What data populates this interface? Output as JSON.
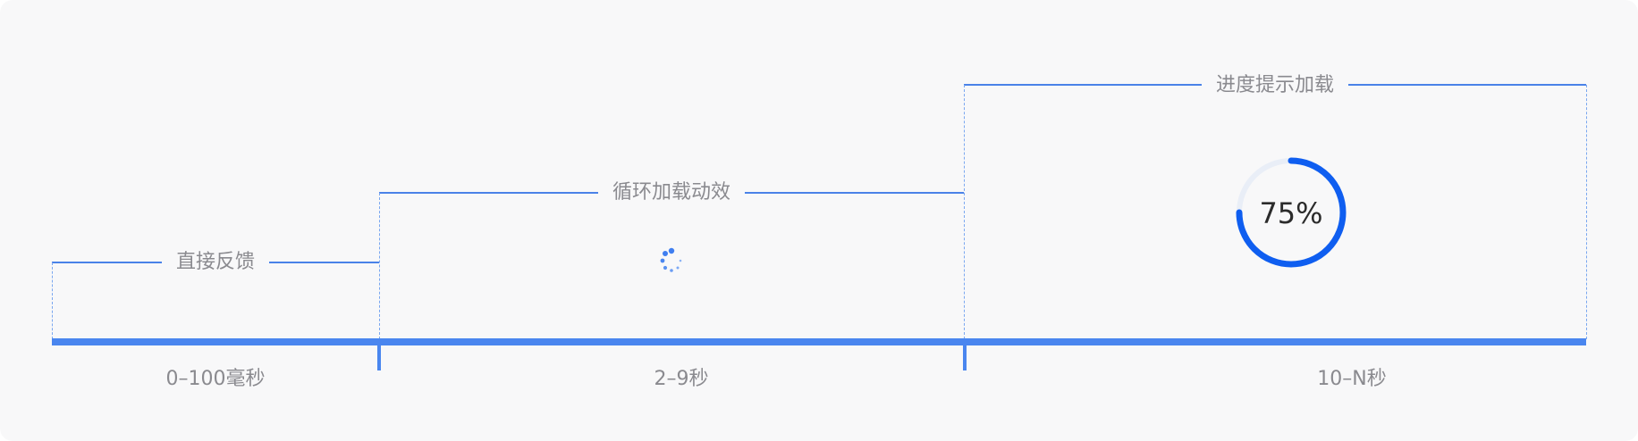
{
  "stages": [
    {
      "title": "直接反馈",
      "range": "0–100毫秒"
    },
    {
      "title": "循环加载动效",
      "range": "2–9秒"
    },
    {
      "title": "进度提示加载",
      "range": "10–N秒"
    }
  ],
  "progress": {
    "value": 0.75,
    "label": "75%"
  },
  "colors": {
    "accent": "#4a86ef",
    "ring": "#0f5ef0",
    "track": "#e9eef7",
    "text": "#8a8a8f"
  }
}
